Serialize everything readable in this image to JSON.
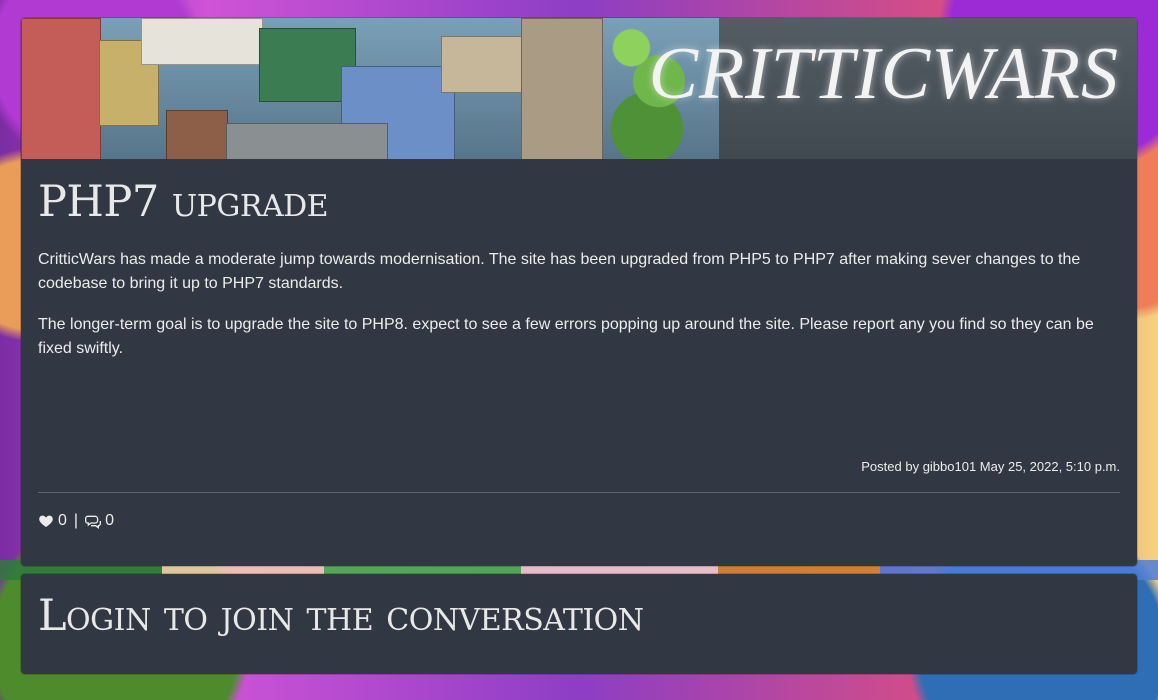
{
  "banner": {
    "brand_name": "CRITTICWARS"
  },
  "post": {
    "title": "PHP7 upgrade",
    "paragraphs": [
      "CritticWars has made a moderate jump towards modernisation. The site has been upgraded from PHP5 to PHP7 after making sever changes to the codebase to bring it up to PHP7 standards.",
      "The longer-term goal is to upgrade the site to PHP8. expect to see a few errors popping up around the site. Please report any you find so they can be fixed swiftly."
    ],
    "meta": "Posted by gibbo101 May 25, 2022, 5:10 p.m.",
    "likes": "0",
    "separator": "|",
    "comments": "0"
  },
  "login_card": {
    "title": "Login to join the conversation"
  },
  "colors": {
    "card_background": "#323843",
    "text": "#ececec",
    "divider": "#5d6470"
  },
  "icons": {
    "like": "heart-icon",
    "comments": "comments-icon"
  }
}
